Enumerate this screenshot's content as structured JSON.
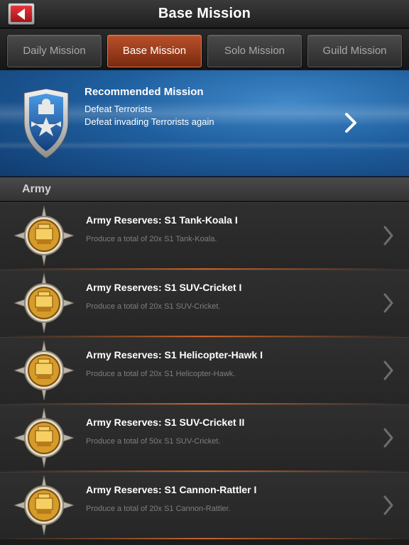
{
  "header": {
    "title": "Base Mission",
    "back_icon": "back-arrow-icon"
  },
  "tabs": [
    {
      "label": "Daily Mission",
      "active": false
    },
    {
      "label": "Base Mission",
      "active": true
    },
    {
      "label": "Solo Mission",
      "active": false
    },
    {
      "label": "Guild Mission",
      "active": false
    }
  ],
  "recommended": {
    "title": "Recommended Mission",
    "line1": "Defeat Terrorists",
    "line2": "Defeat invading Terrorists again",
    "icon": "shield-emblem-icon"
  },
  "section": {
    "label": "Army"
  },
  "missions": [
    {
      "title": "Army Reserves: S1 Tank-Koala I",
      "desc": "Produce a total of 20x S1 Tank-Koala."
    },
    {
      "title": "Army Reserves: S1 SUV-Cricket I",
      "desc": "Produce a total of 20x S1 SUV-Cricket."
    },
    {
      "title": "Army Reserves: S1 Helicopter-Hawk I",
      "desc": "Produce a total of 20x S1 Helicopter-Hawk."
    },
    {
      "title": "Army Reserves: S1 SUV-Cricket II",
      "desc": "Produce a total of 50x S1 SUV-Cricket."
    },
    {
      "title": "Army Reserves: S1 Cannon-Rattler I",
      "desc": "Produce a total of 20x S1 Cannon-Rattler."
    }
  ],
  "colors": {
    "active_tab": "#b9502a",
    "banner_blue": "#1f5f9f",
    "separator": "#c8642a"
  }
}
